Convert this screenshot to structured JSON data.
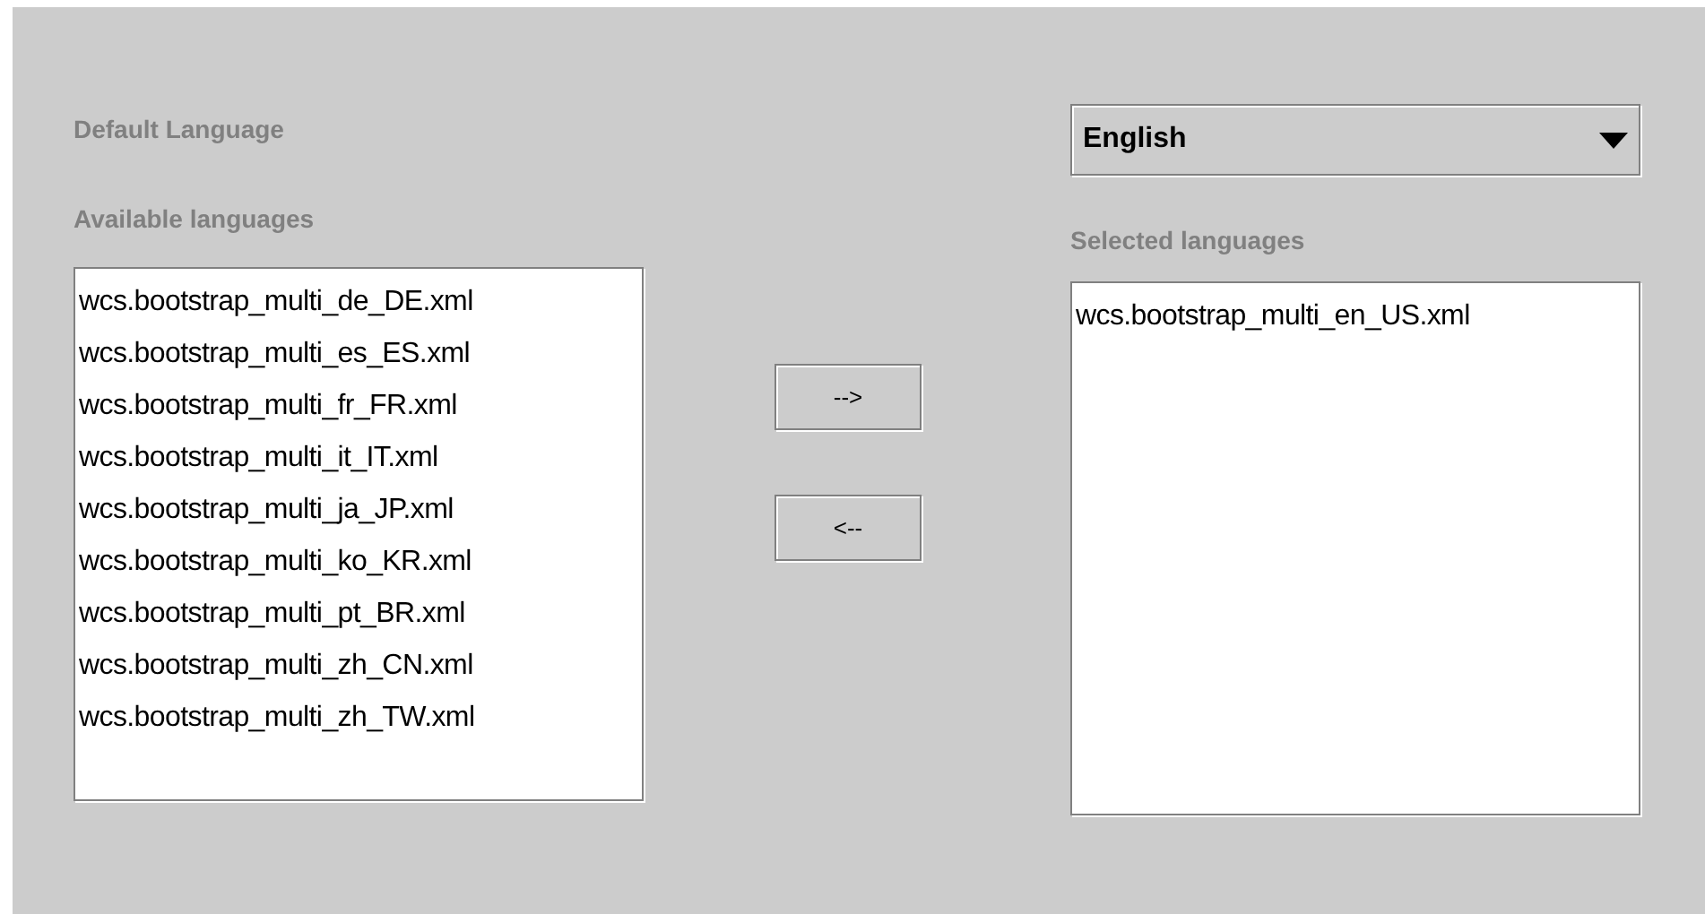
{
  "default_language": {
    "label": "Default Language",
    "dropdown": {
      "value": "English"
    }
  },
  "available": {
    "label": "Available languages",
    "items": [
      "wcs.bootstrap_multi_de_DE.xml",
      "wcs.bootstrap_multi_es_ES.xml",
      "wcs.bootstrap_multi_fr_FR.xml",
      "wcs.bootstrap_multi_it_IT.xml",
      "wcs.bootstrap_multi_ja_JP.xml",
      "wcs.bootstrap_multi_ko_KR.xml",
      "wcs.bootstrap_multi_pt_BR.xml",
      "wcs.bootstrap_multi_zh_CN.xml",
      "wcs.bootstrap_multi_zh_TW.xml"
    ]
  },
  "buttons": [
    "-->",
    "<--"
  ],
  "selected": {
    "label": "Selected languages",
    "items": [
      "wcs.bootstrap_multi_en_US.xml"
    ]
  }
}
